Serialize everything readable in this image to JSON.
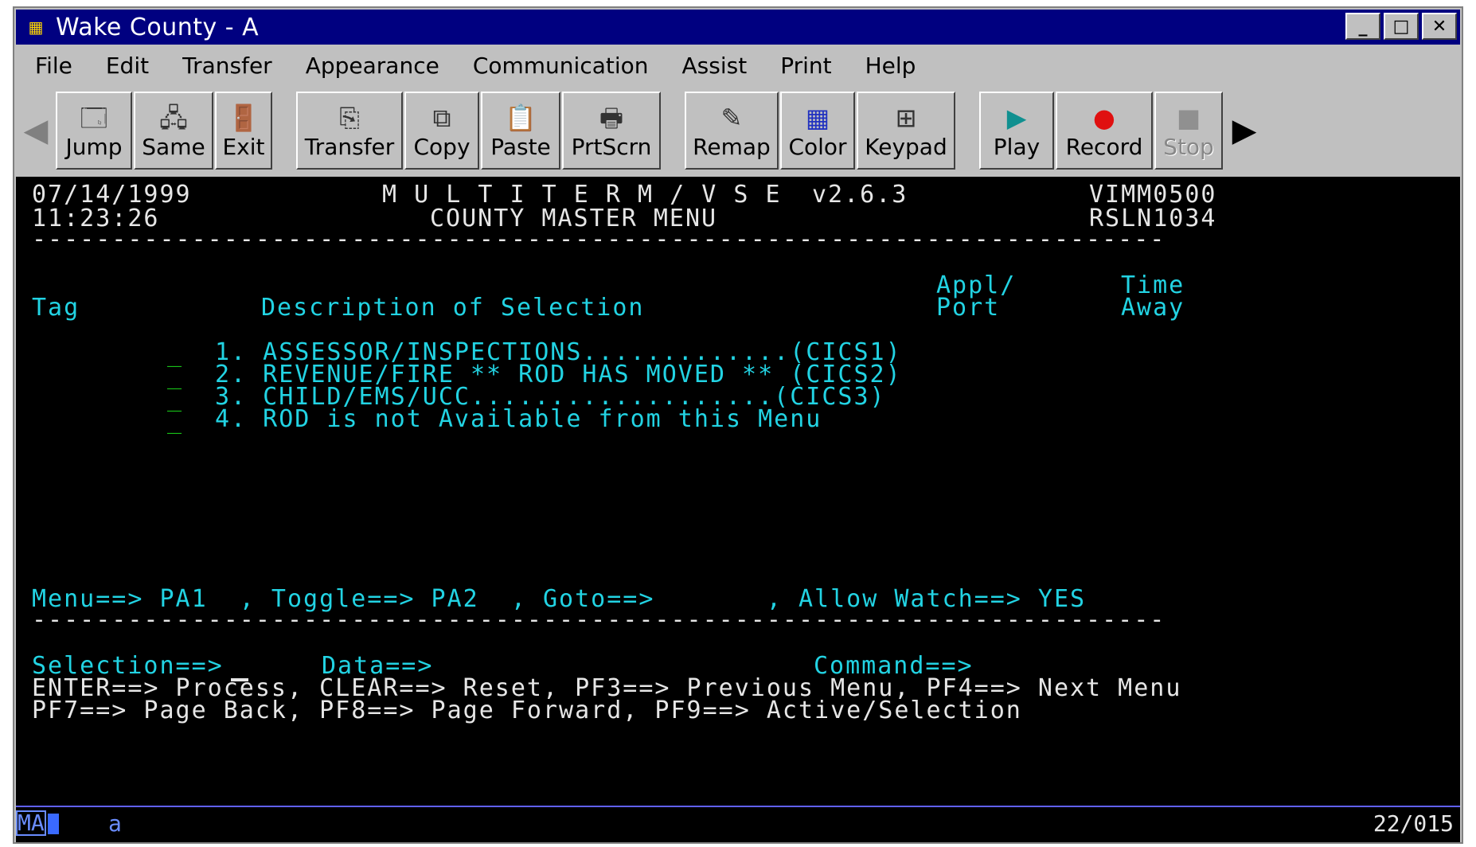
{
  "window": {
    "title": "Wake County - A",
    "minimize": "_",
    "maximize": "□",
    "close": "✕"
  },
  "menu": [
    "File",
    "Edit",
    "Transfer",
    "Appearance",
    "Communication",
    "Assist",
    "Print",
    "Help"
  ],
  "toolbar": {
    "jump": "Jump",
    "same": "Same",
    "exit": "Exit",
    "transfer": "Transfer",
    "copy": "Copy",
    "paste": "Paste",
    "prtscrn": "PrtScrn",
    "remap": "Remap",
    "color": "Color",
    "keypad": "Keypad",
    "play": "Play",
    "record": "Record",
    "stop": "Stop"
  },
  "screen": {
    "date": "07/14/1999",
    "time": "11:23:26",
    "product": "M U L T I T E R M / V S E",
    "version": "v2.6.3",
    "title": "COUNTY MASTER MENU",
    "id1": "VIMM0500",
    "id2": "RSLN1034",
    "col_tag": "Tag",
    "col_desc": "Description of Selection",
    "col_appl1": "Appl/",
    "col_appl2": "Port",
    "col_time1": "Time",
    "col_time2": "Away",
    "items": [
      "1. ASSESSOR/INSPECTIONS.............(CICS1)",
      "2. REVENUE/FIRE ** ROD HAS MOVED ** (CICS2)",
      "3. CHILD/EMS/UCC...................(CICS3)",
      "4. ROD is not Available from this Menu"
    ],
    "menu_line": "Menu==> PA1  , Toggle==> PA2  , Goto==>       , Allow Watch==> YES",
    "selection": "Selection==>",
    "data": "Data==>",
    "command": "Command==>",
    "keys1": "ENTER==> Process, CLEAR==> Reset, PF3==> Previous Menu, PF4==> Next Menu",
    "keys2": "PF7==> Page Back, PF8==> Page Forward, PF9==> Active/Selection"
  },
  "status": {
    "mode": "MA",
    "indicator": "a",
    "cursor_pos": "22/015"
  }
}
